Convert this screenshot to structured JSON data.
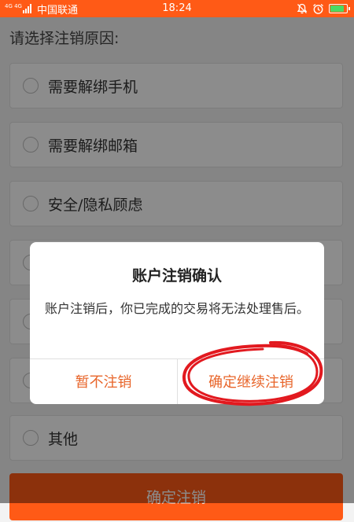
{
  "status_bar": {
    "network_tag": "4G 4G",
    "carrier": "中国联通",
    "time": "18:24",
    "battery_level": 0.9,
    "background": "#ff5a16"
  },
  "page": {
    "prompt": "请选择注销原因:",
    "options": [
      {
        "label": "需要解绑手机"
      },
      {
        "label": "需要解绑邮箱"
      },
      {
        "label": "安全/隐私顾虑"
      },
      {
        "label": ""
      },
      {
        "label": ""
      },
      {
        "label": ""
      },
      {
        "label": "其他"
      }
    ],
    "confirm_button": "确定注销",
    "accent": "#ff5a16"
  },
  "dialog": {
    "title": "账户注销确认",
    "message": "账户注销后，你已完成的交易将无法处理售后。",
    "cancel_label": "暂不注销",
    "confirm_label": "确定继续注销",
    "button_color": "#e8652a",
    "annotation_color": "#e2191f"
  }
}
